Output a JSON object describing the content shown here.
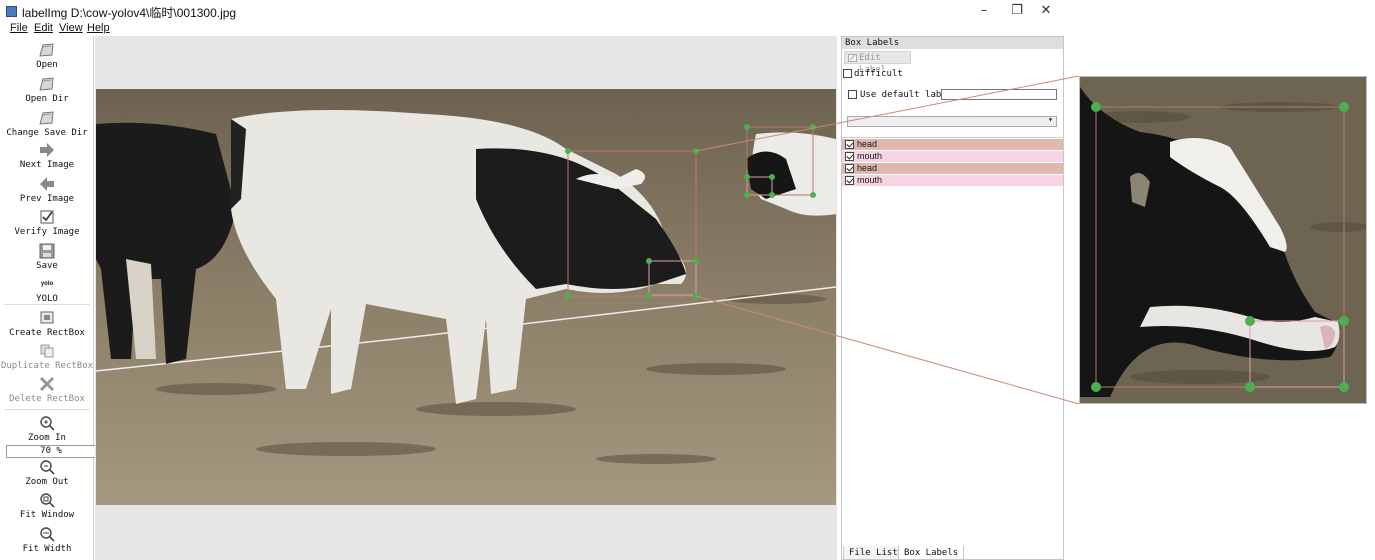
{
  "window": {
    "title": "labelImg D:\\cow-yolov4\\临时\\001300.jpg",
    "minimize": "–",
    "maximize": "❐",
    "close": "✕"
  },
  "menu": {
    "file": "File",
    "edit": "Edit",
    "view": "View",
    "help": "Help"
  },
  "toolbar": {
    "open": "Open",
    "open_dir": "Open Dir",
    "change_save_dir": "Change Save Dir",
    "next_image": "Next Image",
    "prev_image": "Prev Image",
    "verify_image": "Verify Image",
    "save": "Save",
    "format_icon_text": "yolo",
    "format": "YOLO",
    "create_rectbox": "Create RectBox",
    "duplicate_rectbox": "Duplicate RectBox",
    "delete_rectbox": "Delete RectBox",
    "zoom_in": "Zoom In",
    "zoom_value": "70 %",
    "zoom_out": "Zoom Out",
    "fit_window": "Fit Window",
    "fit_width": "Fit Width"
  },
  "dock": {
    "title": "Box Labels",
    "edit_label": "Edit Label",
    "difficult": "difficult",
    "difficult_checked": false,
    "use_default_label": "Use default label",
    "use_default_checked": false,
    "default_label_value": "",
    "combo_value": "",
    "labels": [
      {
        "text": "head",
        "checked": true,
        "color": "#dfb8b0"
      },
      {
        "text": "mouth",
        "checked": true,
        "color": "#f7d4e4"
      },
      {
        "text": "head",
        "checked": true,
        "color": "#dfb8b0"
      },
      {
        "text": "mouth",
        "checked": true,
        "color": "#f7d4e4"
      }
    ],
    "tabs": {
      "file_list": "File List",
      "box_labels": "Box Labels"
    }
  },
  "colors": {
    "handle": "#4caf50",
    "box_head": "#b77b6b",
    "box_mouth": "#d9a0b0"
  }
}
